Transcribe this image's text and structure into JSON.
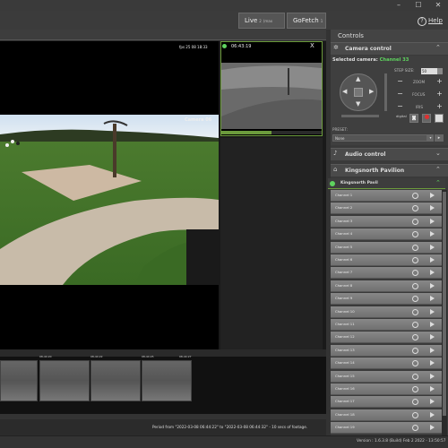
{
  "window": {
    "controls": [
      "–",
      "☐",
      "✕"
    ]
  },
  "top_tabs": [
    {
      "label": "Live",
      "sup": "2",
      "sub": "(max 32)"
    },
    {
      "label": "GoFetch",
      "sup": "1",
      "sub": ""
    }
  ],
  "help_label": "Help",
  "main_view": {
    "camera_label": "Camera 06",
    "overlay_text": "fps 25 08 18:33"
  },
  "side_view": {
    "timestamp": "06:43:19",
    "close": "X"
  },
  "timeline": {
    "thumb_timestamps": [
      "08-44:20",
      "08-44:22",
      "08-44:25",
      "08-44:27"
    ],
    "period_text": "Period from \"2022-03-08 06:44:22\" to \"2022-03-08 06:44:32\" - 10 secs of footage."
  },
  "status": {
    "version": "Version : 1.6.3.8 (Build) Feb 2 2022 - 13:50:57"
  },
  "controls": {
    "title": "Controls",
    "camera_control": {
      "title": "Camera control",
      "selected_label": "Selected camera:",
      "selected_value": "Channel 33",
      "step_size_label": "STEP SIZE:",
      "step_size_value": "50",
      "zoom_label": "ZOOM",
      "focus_label": "FOCUS",
      "iris_label": "IRIS",
      "digital_label": "digital",
      "preset_label": "PRESET:",
      "preset_value": "None"
    },
    "audio_control": {
      "title": "Audio control"
    },
    "site": {
      "title": "Kingsnorth Pavilion"
    },
    "group": {
      "title": "Kingsnorth Pavil"
    },
    "channels": [
      "Channel 1",
      "Channel 2",
      "Channel 3",
      "Channel 4",
      "Channel 5",
      "Channel 6",
      "Channel 7",
      "Channel 8",
      "Channel 9",
      "Channel 10",
      "Channel 11",
      "Channel 12",
      "Channel 13",
      "Channel 14",
      "Channel 15",
      "Channel 16",
      "Channel 17",
      "Channel 18",
      "Channel 19",
      "Channel 20"
    ]
  },
  "colors": {
    "accent_green": "#5fd45f",
    "record_red": "#e03030",
    "selection_border": "#6c9b3c"
  },
  "icons": [
    "minimize-icon",
    "maximize-icon",
    "close-icon",
    "help-icon",
    "camera-control-icon",
    "audio-control-icon",
    "site-icon",
    "power-icon",
    "play-icon",
    "snapshot-icon",
    "record-icon"
  ]
}
